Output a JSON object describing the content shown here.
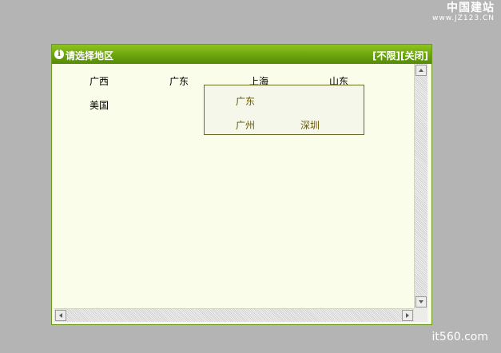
{
  "watermark": {
    "top_right_cn": "中国建站",
    "top_right_en": "www.JZ123.CN",
    "bottom_right": "it560.com"
  },
  "dialog": {
    "title": "请选择地区",
    "unlimited_button": "[不限]",
    "close_button": "[关闭]",
    "regions": [
      "广西",
      "广东",
      "上海",
      "山东",
      "美国"
    ],
    "popup": {
      "province": "广东",
      "cities": [
        "广州",
        "深圳"
      ]
    }
  },
  "colors": {
    "title_bar": "#6ba40d",
    "dialog_background": "#f9fdea",
    "popup_text": "#6a5800",
    "page_background": "#b4b4b4"
  }
}
